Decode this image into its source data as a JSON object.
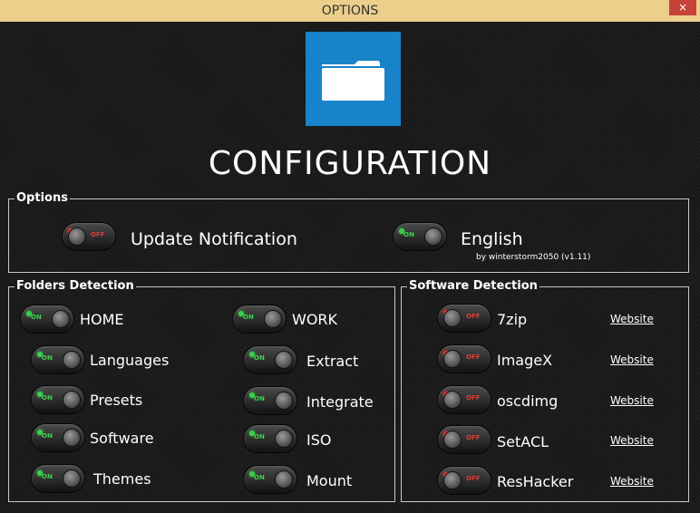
{
  "window": {
    "title": "OPTIONS",
    "close_label": "×"
  },
  "header": {
    "logo_icon": "folder-icon",
    "title": "CONFIGURATION"
  },
  "colors": {
    "accent": "#1883c8",
    "titlebar": "#ebcf8a",
    "on": "#39d14a",
    "off": "#e4342d"
  },
  "toggle_text": {
    "on": "ON",
    "off": "OFF"
  },
  "options": {
    "legend": "Options",
    "update_notification": {
      "label": "Update Notification",
      "state": "off"
    },
    "language": {
      "label": "English",
      "state": "on"
    },
    "credit": "by winterstorm2050 (v1.11)"
  },
  "folders": {
    "legend": "Folders Detection",
    "home": {
      "label": "HOME",
      "state": "on"
    },
    "work": {
      "label": "WORK",
      "state": "on"
    },
    "items": [
      {
        "label": "Languages",
        "state": "on"
      },
      {
        "label": "Presets",
        "state": "on"
      },
      {
        "label": "Software",
        "state": "on"
      },
      {
        "label": "Themes",
        "state": "on"
      },
      {
        "label": "Extract",
        "state": "on"
      },
      {
        "label": "Integrate",
        "state": "on"
      },
      {
        "label": "ISO",
        "state": "on"
      },
      {
        "label": "Mount",
        "state": "on"
      }
    ]
  },
  "software": {
    "legend": "Software Detection",
    "link_label": "Website",
    "items": [
      {
        "label": "7zip",
        "state": "off"
      },
      {
        "label": "ImageX",
        "state": "off"
      },
      {
        "label": "oscdimg",
        "state": "off"
      },
      {
        "label": "SetACL",
        "state": "off"
      },
      {
        "label": "ResHacker",
        "state": "off"
      }
    ]
  }
}
